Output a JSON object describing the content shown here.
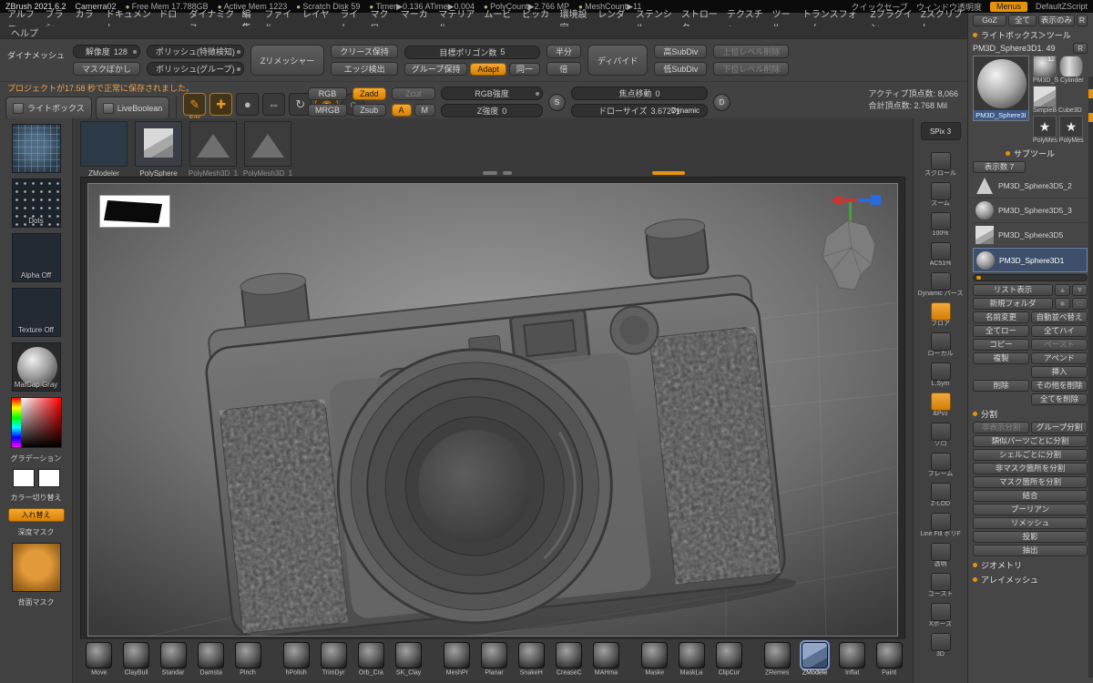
{
  "titlebar": {
    "app": "ZBrush 2021.6.2",
    "document": "Camerra02",
    "stats": [
      "Free Mem 17.788GB",
      "Active Mem 1223",
      "Scratch Disk 59",
      "Timer▶0.136 ATime▶0.004",
      "PolyCount▶2.766 MP",
      "MeshCount▶11"
    ],
    "quicksave": "クイックセーブ",
    "window_opacity": "ウィンドウ透明度",
    "menus": "Menus",
    "zscript": "DefaultZScript"
  },
  "menubar": {
    "items": [
      "アルファ",
      "ブラシ",
      "カラー",
      "ドキュメント",
      "ドロー",
      "ダイナミクス",
      "編集",
      "ファイル",
      "レイヤー",
      "ライト",
      "マクロ",
      "マーカー",
      "マテリアル",
      "ムービー",
      "ピッカー",
      "環境設定",
      "レンダー",
      "ステンシル",
      "ストローク",
      "テクスチャ",
      "ツール",
      "トランスフォーム",
      "Zプラグイン",
      "Zスクリプト"
    ],
    "help": "ヘルプ"
  },
  "shelf": {
    "dynamesh": "ダイナメッシュ",
    "resolution_label": "解像度",
    "resolution_value": "128",
    "mask_blur": "マスクぼかし",
    "polish_feature": "ポリッシュ(特徴検知)",
    "polish_group": "ポリッシュ(グループ)",
    "zremesher": "Zリメッシャー",
    "keep_crease": "クリース保持",
    "edge_detect": "エッジ検出",
    "target_label": "目標ポリゴン数",
    "target_value": "5",
    "keep_groups": "グループ保持",
    "adapt": "Adapt",
    "same": "同一",
    "half": "半分",
    "double": "倍",
    "divide": "ディバイド",
    "high_subdiv": "高SubDiv",
    "low_subdiv": "低SubDiv",
    "del_higher": "上位レベル削除",
    "del_lower": "下位レベル削除"
  },
  "status": {
    "message": "プロジェクトが17.58 秒で正常に保存されました。",
    "lightbox": "ライトボックス",
    "live_boolean": "LiveBoolean",
    "mode_icons": [
      {
        "glyph": "✎",
        "label": "Edit",
        "on": true,
        "name": "edit-mode"
      },
      {
        "glyph": "✚",
        "on": true,
        "name": "transpose-gyro"
      },
      {
        "glyph": "●",
        "name": "draw-mode"
      },
      {
        "glyph": "⇔",
        "name": "scale-mode"
      },
      {
        "glyph": "↻",
        "name": "rotate-mode"
      },
      {
        "glyph": "◉",
        "on": true,
        "round": true,
        "name": "sculptris-pro-toggle"
      },
      {
        "glyph": "○",
        "round": true,
        "name": "dynamic-subdiv-toggle"
      }
    ],
    "rgb": "RGB",
    "mrgb": "MRGB",
    "zadd": "Zadd",
    "zsub": "Zsub",
    "zcut": "Zcut",
    "rgb_intensity": "RGB強度",
    "a": "A",
    "m": "M",
    "z_intensity_label": "Z強度",
    "z_intensity_value": "0",
    "s_knob": "S",
    "d_knob": "D",
    "focal_label": "焦点移動",
    "focal_value": "0",
    "drawsize_label": "ドローサイズ",
    "drawsize_value": "3.67271",
    "dynamic": "Dynamic",
    "active_points": "アクティブ頂点数: 8,066",
    "total_points": "合計頂点数: 2.768 Mil"
  },
  "tool_shelf": [
    {
      "label": "ZModeler",
      "kind": "wire"
    },
    {
      "label": "PolySphere",
      "kind": "cube"
    },
    {
      "label": "PolyMesh3D_1",
      "kind": "mesh"
    },
    {
      "label": "PolyMesh3D_1",
      "kind": "mesh"
    }
  ],
  "left_sidebar": {
    "stroke": "Dots",
    "alpha": "Alpha Off",
    "texture": "Texture Off",
    "material": "MatCap Gray",
    "gradient": "グラデーション",
    "color_switch": "カラー切り替え",
    "swap": "入れ替え",
    "depth_mask": "深度マスク",
    "back_mask": "背面マスク"
  },
  "right_strip": [
    {
      "label": "SPix 3",
      "spix": true
    },
    {
      "label": "スクロール"
    },
    {
      "label": "ズーム"
    },
    {
      "label": "100%"
    },
    {
      "label": "AC51%"
    },
    {
      "label": "Dynamic パース"
    },
    {
      "label": "フロア",
      "on": true
    },
    {
      "label": "ローカル"
    },
    {
      "label": "L.Sym"
    },
    {
      "label": "&Pvz",
      "on": true
    },
    {
      "label": "ソロ"
    },
    {
      "label": "フレーム"
    },
    {
      "label": "Z-LOD"
    },
    {
      "label": "Line Fill ポリF"
    },
    {
      "label": "透明"
    },
    {
      "label": "ゴースト"
    },
    {
      "label": "Xポーズ"
    },
    {
      "label": "3D"
    }
  ],
  "right_panel": {
    "goz": "GoZ",
    "all": "全て",
    "show_only": "表示のみ",
    "r": "R",
    "r2": "R",
    "lightbox_tool": "ライトボックス＞ツール",
    "tool_title": "PM3D_Sphere3D1. 49",
    "big_thumb_label": "PM3D_Sphere3I",
    "mini_tools": [
      {
        "caption": "PM3D_S Cylinder",
        "shapes": [
          "sphere",
          "cylinder"
        ],
        "badge": "12"
      },
      {
        "caption": "SimpleB Cube3D",
        "shapes": [
          "cube"
        ]
      },
      {
        "caption": "PolyMes PolyMes",
        "shapes": [
          "star",
          "star"
        ]
      }
    ],
    "subtool_header": "サブツール",
    "visible_count": "表示数 7",
    "subtools": [
      {
        "name": "PM3D_Sphere3D5_2",
        "shape": "cone"
      },
      {
        "name": "PM3D_Sphere3D5_3",
        "shape": "sphere"
      },
      {
        "name": "PM3D_Sphere3D5",
        "shape": "cube"
      },
      {
        "name": "PM3D_Sphere3D1",
        "shape": "sphere",
        "selected": true
      }
    ],
    "subtool_rows": [
      [
        {
          "t": "リスト表示",
          "f": 2
        },
        {
          "t": "▲",
          "d": 1,
          "f": 0.35
        },
        {
          "t": "▼",
          "d": 1,
          "f": 0.35
        }
      ],
      [
        {
          "t": "新規フォルダ",
          "f": 2
        },
        {
          "t": "■",
          "d": 1,
          "f": 0.35
        },
        {
          "t": "□",
          "d": 1,
          "f": 0.35
        }
      ],
      [
        {
          "t": "名前変更"
        },
        {
          "t": "自動並べ替え"
        }
      ],
      [
        {
          "t": "全てロー"
        },
        {
          "t": "全てハイ"
        }
      ],
      [
        {
          "t": "コピー"
        },
        {
          "t": "ペースト",
          "d": 1
        }
      ],
      [
        {
          "t": "複製"
        },
        {
          "t": "アペンド"
        }
      ],
      [
        {
          "t": "",
          "g": 1
        },
        {
          "t": "挿入"
        }
      ],
      [
        {
          "t": "削除"
        },
        {
          "t": "その他を削除"
        }
      ],
      [
        {
          "t": "",
          "g": 1
        },
        {
          "t": "全てを削除"
        }
      ]
    ],
    "split_header": "分割",
    "split_rows": [
      [
        {
          "t": "非表示分割",
          "d": 1
        },
        {
          "t": "グループ分割"
        }
      ],
      [
        {
          "t": "類似パーツごとに分割"
        }
      ],
      [
        {
          "t": "シェルごとに分割"
        }
      ],
      [
        {
          "t": "非マスク箇所を分割"
        }
      ],
      [
        {
          "t": "マスク箇所を分割"
        }
      ]
    ],
    "bottom_rows": [
      [
        {
          "t": "結合"
        }
      ],
      [
        {
          "t": "ブーリアン"
        }
      ],
      [
        {
          "t": "リメッシュ"
        }
      ],
      [
        {
          "t": "投影"
        }
      ],
      [
        {
          "t": "抽出"
        }
      ]
    ],
    "geometry": "ジオメトリ",
    "array_mesh": "アレイメッシュ"
  },
  "brushes": [
    {
      "label": "Move"
    },
    {
      "label": "ClayBuil"
    },
    {
      "label": "Standar"
    },
    {
      "label": "Damsta"
    },
    {
      "label": "Pinch"
    },
    {
      "label": "hPolish",
      "gap": true
    },
    {
      "label": "TrimDyr"
    },
    {
      "label": "Orb_Cra"
    },
    {
      "label": "SK_Clay"
    },
    {
      "label": "MeshPr",
      "gap": true
    },
    {
      "label": "Planar"
    },
    {
      "label": "SnakeH"
    },
    {
      "label": "CreaseC"
    },
    {
      "label": "MAHma"
    },
    {
      "label": "Maske",
      "gap": true
    },
    {
      "label": "MaskLa"
    },
    {
      "label": "ClipCur"
    },
    {
      "label": "ZRemes",
      "gap": true
    },
    {
      "label": "ZModele",
      "selected": true
    },
    {
      "label": "Inflat"
    },
    {
      "label": "Paint"
    }
  ],
  "colors": {
    "accent": "#e8930c",
    "selection": "#3e4f6b",
    "message": "#f0a24a"
  }
}
